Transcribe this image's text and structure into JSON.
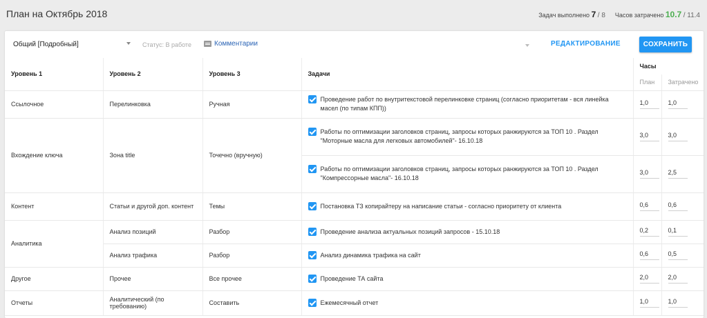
{
  "header": {
    "title": "План на Октябрь 2018",
    "tasks_done_label": "Задач выполнено",
    "tasks_done": "7",
    "tasks_total": "/ 8",
    "hours_label": "Часов затрачено",
    "hours_spent": "10.7",
    "hours_total": "/ 11.4"
  },
  "toolbar": {
    "view_select": "Общий [Подробный]",
    "status": "Статус: В работе",
    "comments": "Комментарии",
    "edit_label": "РЕДАКТИРОВАНИЕ",
    "save_label": "СОХРАНИТЬ"
  },
  "colors": {
    "accent": "#2196f3",
    "green": "#4caf50",
    "link": "#2b64b5"
  },
  "table": {
    "headers": {
      "level1": "Уровень 1",
      "level2": "Уровень 2",
      "level3": "Уровень 3",
      "tasks": "Задачи",
      "hours": "Часы",
      "plan": "План",
      "spent": "Затрачено"
    },
    "rows": [
      {
        "l1": "Ссылочное",
        "l2": "Перелинковка",
        "l3": "Ручная",
        "task": "Проведение работ по внутритекстовой перелинковке страниц (согласно приоритетам - вся линейка масел (по типам КПП))",
        "plan": "1,0",
        "spent": "1,0"
      },
      {
        "l1": "Вхождение ключа",
        "l2": "Зона title",
        "l3": "Точечно (вручную)",
        "task": "Работы по оптимизации заголовков страниц, запросы которых ранжируются за ТОП 10 . Раздел \"Моторные масла для легковых автомобилей\"- 16.10.18",
        "plan": "3,0",
        "spent": "3,0"
      },
      {
        "task": "Работы по оптимизации заголовков страниц, запросы которых ранжируются за ТОП 10 . Раздел \"Компрессорные масла\"- 16.10.18",
        "plan": "3,0",
        "spent": "2,5"
      },
      {
        "l1": "Контент",
        "l2": "Статьи и другой доп. контент",
        "l3": "Темы",
        "task": "Постановка ТЗ копирайтеру на написание статьи - согласно приоритету от клиента",
        "plan": "0,6",
        "spent": "0,6"
      },
      {
        "l1": "Аналитика",
        "l2": "Анализ позиций",
        "l3": "Разбор",
        "task": "Проведение анализа актуальных позиций запросов - 15.10.18",
        "plan": "0,2",
        "spent": "0,1"
      },
      {
        "l2": "Анализ трафика",
        "l3": "Разбор",
        "task": "Анализ динамика трафика на сайт",
        "plan": "0,6",
        "spent": "0,5"
      },
      {
        "l1": "Другое",
        "l2": "Прочее",
        "l3": "Все прочее",
        "task": "Проведение ТА сайта",
        "plan": "2,0",
        "spent": "2,0"
      },
      {
        "l1": "Отчеты",
        "l2": "Аналитический (по требованию)",
        "l3": "Составить",
        "task": "Ежемесячный отчет",
        "plan": "1,0",
        "spent": "1,0"
      }
    ]
  }
}
